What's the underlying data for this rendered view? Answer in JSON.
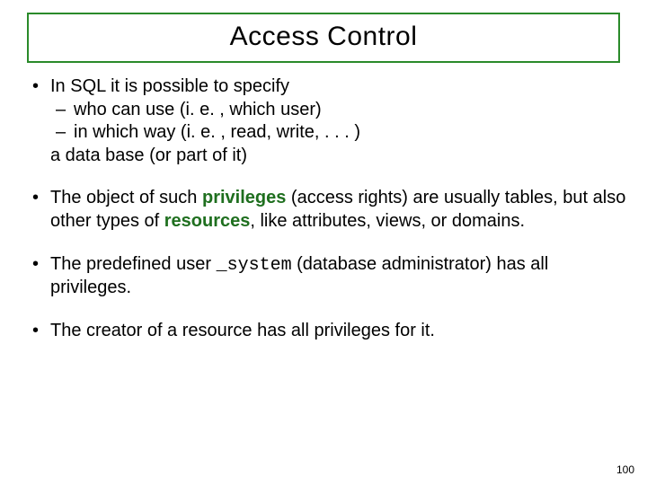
{
  "title": "Access Control",
  "bullets": {
    "b1": {
      "line1": "In SQL it is possible to specify",
      "sub1": "who can use (i. e. , which user)",
      "sub2": "in which way (i. e. , read, write, . . . )",
      "line2": "a data base (or part of it)"
    },
    "b2": {
      "pre": "The object of such ",
      "kw1": "privileges",
      "mid1": " (access rights) are usually tables, but also other types of ",
      "kw2": "resources",
      "post": ", like attributes, views, or domains."
    },
    "b3": {
      "pre": "The predefined user ",
      "sys": "_system",
      "post": " (database administrator) has all privileges."
    },
    "b4": "The creator of a resource has all privileges for it."
  },
  "page_number": "100"
}
